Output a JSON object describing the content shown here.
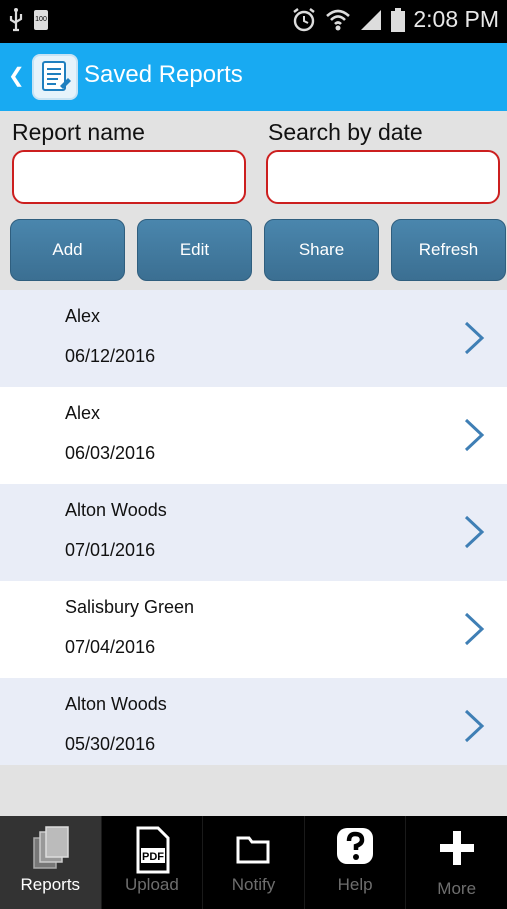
{
  "status": {
    "time": "2:08 PM",
    "battery_small": "100"
  },
  "appbar": {
    "title": "Saved Reports"
  },
  "form": {
    "report_name_label": "Report name",
    "search_date_label": "Search by date",
    "report_name_value": "",
    "search_date_value": "",
    "buttons": {
      "add": "Add",
      "edit": "Edit",
      "share": "Share",
      "refresh": "Refresh"
    }
  },
  "reports": [
    {
      "name": "Alex",
      "date": "06/12/2016"
    },
    {
      "name": "Alex",
      "date": "06/03/2016"
    },
    {
      "name": "Alton Woods",
      "date": "07/01/2016"
    },
    {
      "name": "Salisbury Green",
      "date": "07/04/2016"
    },
    {
      "name": "Alton Woods",
      "date": "05/30/2016"
    }
  ],
  "tabs": [
    {
      "label": "Reports",
      "icon": "reports-icon"
    },
    {
      "label": "Upload",
      "icon": "pdf-icon",
      "pdf_text": "PDF"
    },
    {
      "label": "Notify",
      "icon": "folder-icon"
    },
    {
      "label": "Help",
      "icon": "help-icon"
    },
    {
      "label": "More",
      "icon": "plus-icon"
    }
  ],
  "colors": {
    "appbar": "#18aaf2",
    "button": "#3f7aa0",
    "input_border": "#cc1f1f",
    "chevron": "#3f7fb5"
  }
}
